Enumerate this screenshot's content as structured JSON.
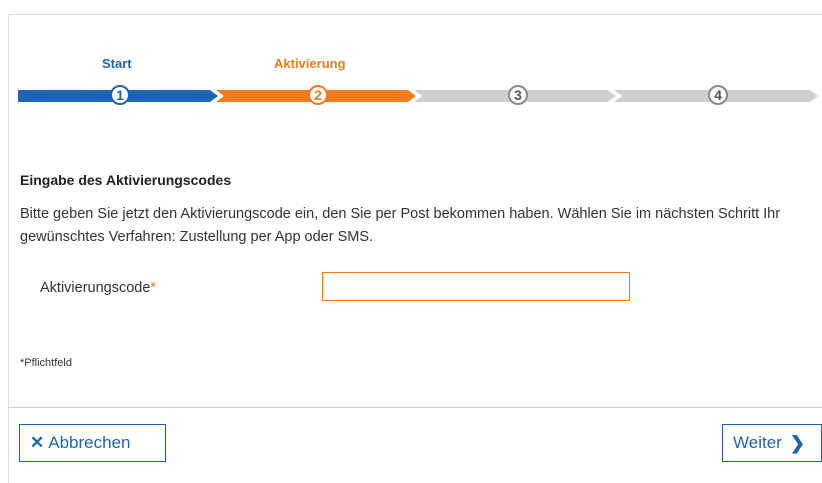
{
  "stepper": {
    "steps": [
      {
        "label": "Start",
        "number": "1"
      },
      {
        "label": "Aktivierung",
        "number": "2"
      },
      {
        "label": "",
        "number": "3"
      },
      {
        "label": "",
        "number": "4"
      }
    ],
    "current_step": 2
  },
  "form": {
    "title": "Eingabe des Aktivierungscodes",
    "description": "Bitte geben Sie jetzt den Aktivierungscode ein, den Sie per Post bekommen haben. Wählen Sie im nächsten Schritt Ihr gewünschtes Verfahren: Zustellung per App oder SMS.",
    "code_label": "Aktivierungscode",
    "required_marker": "*",
    "code_value": "",
    "required_note": "*Pflichtfeld"
  },
  "footer": {
    "cancel_icon": "✕",
    "cancel_label": "Abbrechen",
    "next_label": "Weiter",
    "next_icon": "❯"
  },
  "colors": {
    "primary_blue": "#1e64b4",
    "accent_orange": "#f07c1e",
    "inactive_gray": "#cfcfcf"
  }
}
